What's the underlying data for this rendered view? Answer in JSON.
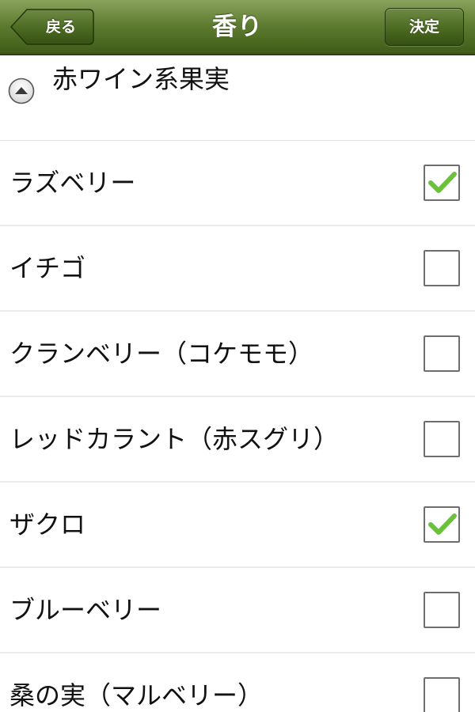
{
  "navbar": {
    "title": "香り",
    "back_label": "戻る",
    "done_label": "決定",
    "bar_color": "#5f7d31"
  },
  "section": {
    "title": "赤ワイン系果実",
    "state": "expanded"
  },
  "items": [
    {
      "label": "ラズベリー",
      "checked": true
    },
    {
      "label": "イチゴ",
      "checked": false
    },
    {
      "label": "クランベリー（コケモモ）",
      "checked": false
    },
    {
      "label": "レッドカラント（赤スグリ）",
      "checked": false
    },
    {
      "label": "ザクロ",
      "checked": true
    },
    {
      "label": "ブルーベリー",
      "checked": false
    },
    {
      "label": "桑の実（マルベリー）",
      "checked": false
    }
  ],
  "colors": {
    "check_mark": "#6cc13a",
    "checkbox_border": "#6e6e6e"
  }
}
